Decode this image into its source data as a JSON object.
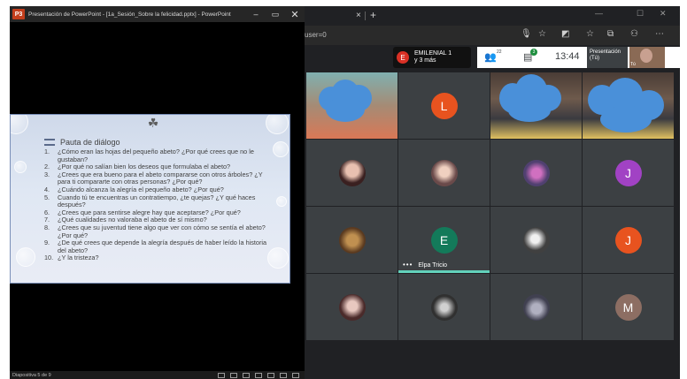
{
  "ppt": {
    "logo": "P3",
    "title": "Presentación de PowerPoint - [1a_Sesión_Sobre la felicidad.pptx] - PowerPoint",
    "buttons": {
      "minimize": "–",
      "maximize": "▭",
      "close": "✕"
    },
    "slide": {
      "heading": "Pauta de diálogo",
      "items": [
        {
          "num": "1.",
          "text": "¿Cómo eran las hojas del pequeño abeto? ¿Por qué crees que no le gustaban?"
        },
        {
          "num": "2.",
          "text": "¿Por qué no salían bien los deseos que formulaba el abeto?"
        },
        {
          "num": "3.",
          "text": "¿Crees que era bueno para el abeto compararse con otros árboles? ¿Y para ti compararte con otras personas? ¿Por qué?"
        },
        {
          "num": "4.",
          "text": "¿Cuándo alcanza la alegría el pequeño abeto? ¿Por qué?"
        },
        {
          "num": "5.",
          "text": "Cuando tú te encuentras un contratiempo, ¿te quejas? ¿Y qué haces después?"
        },
        {
          "num": "6.",
          "text": "¿Crees que para sentirse alegre hay que aceptarse? ¿Por qué?"
        },
        {
          "num": "7.",
          "text": "¿Qué cualidades no valoraba el abeto de sí mismo?"
        },
        {
          "num": "8.",
          "text": "¿Crees que su juventud tiene algo que ver con cómo se sentía el abeto? ¿Por qué?"
        },
        {
          "num": "9.",
          "text": " ¿De qué crees que depende la alegría después de haber leído la historia del abeto?"
        },
        {
          "num": "10.",
          "text": "¿Y la tristeza?"
        }
      ]
    },
    "status": {
      "slide_count": "Diapositiva 5 de 9"
    }
  },
  "browser": {
    "tab_close": "×",
    "tab_new": "+",
    "window_buttons": {
      "minimize": "—",
      "maximize": "☐",
      "close": "✕"
    },
    "url": "user=0",
    "icons": [
      "mic-icon",
      "star-icon",
      "extension-icon",
      "favorites-icon",
      "collections-icon",
      "profile-icon",
      "more-icon"
    ]
  },
  "meet": {
    "presenter_chip": {
      "initial": "E",
      "name": "EMILENIAL 1",
      "more": "y 3 más"
    },
    "participants_count": "22",
    "chat_count": "3",
    "time": "13:44",
    "presentation_tile": {
      "line1": "Presentación",
      "line2": "(Tú)"
    },
    "self_tile_label": "Tú",
    "tiles": [
      {
        "kind": "video-orange",
        "initial": ""
      },
      {
        "kind": "avatar",
        "initial": "L",
        "color": "#e8531f"
      },
      {
        "kind": "video-classroom",
        "initial": ""
      },
      {
        "kind": "video-classroom",
        "initial": ""
      },
      {
        "kind": "photo",
        "initial": "",
        "color": "#b07080"
      },
      {
        "kind": "photo",
        "initial": "",
        "color": "#c89080"
      },
      {
        "kind": "photo",
        "initial": "",
        "color": "#b050a0"
      },
      {
        "kind": "avatar",
        "initial": "J",
        "color": "#a142c4"
      },
      {
        "kind": "photo",
        "initial": "",
        "color": "#8a6030"
      },
      {
        "kind": "avatar",
        "initial": "E",
        "color": "#137a5a",
        "name": "Elpa Tricio",
        "speaking": true
      },
      {
        "kind": "photo",
        "initial": "",
        "color": "#707070"
      },
      {
        "kind": "avatar",
        "initial": "J",
        "color": "#e8531f"
      },
      {
        "kind": "photo",
        "initial": "",
        "color": "#906060"
      },
      {
        "kind": "photo",
        "initial": "",
        "color": "#505050"
      },
      {
        "kind": "photo",
        "initial": "",
        "color": "#6a6a80"
      },
      {
        "kind": "avatar",
        "initial": "M",
        "color": "#8d6e63"
      }
    ],
    "dots": "•••"
  }
}
